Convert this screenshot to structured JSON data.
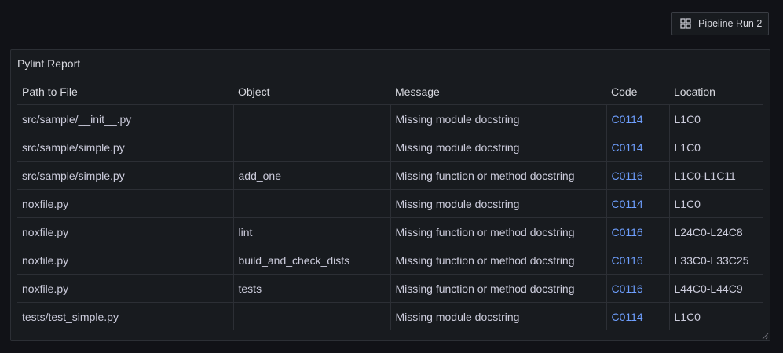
{
  "header": {
    "run_button_label": "Pipeline Run 2",
    "run_button_icon": "grid-icon"
  },
  "panel": {
    "title": "Pylint Report",
    "columns": [
      "Path to File",
      "Object",
      "Message",
      "Code",
      "Location"
    ],
    "rows": [
      {
        "path": "src/sample/__init__.py",
        "object": "",
        "message": "Missing module docstring",
        "code": "C0114",
        "location": "L1C0"
      },
      {
        "path": "src/sample/simple.py",
        "object": "",
        "message": "Missing module docstring",
        "code": "C0114",
        "location": "L1C0"
      },
      {
        "path": "src/sample/simple.py",
        "object": "add_one",
        "message": "Missing function or method docstring",
        "code": "C0116",
        "location": "L1C0-L1C11"
      },
      {
        "path": "noxfile.py",
        "object": "",
        "message": "Missing module docstring",
        "code": "C0114",
        "location": "L1C0"
      },
      {
        "path": "noxfile.py",
        "object": "lint",
        "message": "Missing function or method docstring",
        "code": "C0116",
        "location": "L24C0-L24C8"
      },
      {
        "path": "noxfile.py",
        "object": "build_and_check_dists",
        "message": "Missing function or method docstring",
        "code": "C0116",
        "location": "L33C0-L33C25"
      },
      {
        "path": "noxfile.py",
        "object": "tests",
        "message": "Missing function or method docstring",
        "code": "C0116",
        "location": "L44C0-L44C9"
      },
      {
        "path": "tests/test_simple.py",
        "object": "",
        "message": "Missing module docstring",
        "code": "C0114",
        "location": "L1C0"
      }
    ]
  },
  "colors": {
    "background": "#111217",
    "panel": "#181b1f",
    "border": "#2c2f35",
    "text": "#ccccdc",
    "code_link": "#6e9fff"
  }
}
